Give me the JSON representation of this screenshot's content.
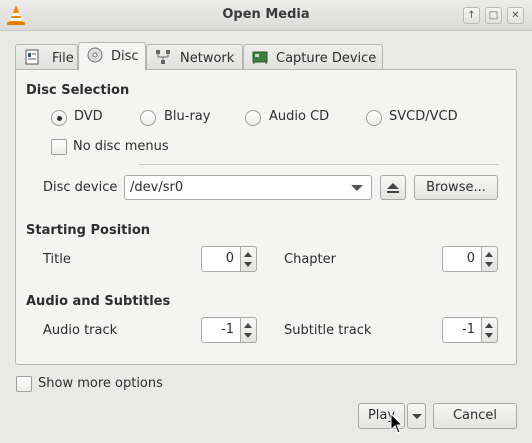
{
  "window": {
    "title": "Open Media",
    "controls": [
      "up-arrow-icon",
      "maximize-icon",
      "close-icon"
    ]
  },
  "tabs": [
    {
      "label": "File",
      "icon": "file-icon",
      "active": false
    },
    {
      "label": "Disc",
      "icon": "disc-icon",
      "active": true
    },
    {
      "label": "Network",
      "icon": "network-icon",
      "active": false
    },
    {
      "label": "Capture Device",
      "icon": "capture-card-icon",
      "active": false
    }
  ],
  "disc_selection": {
    "title": "Disc Selection",
    "options": [
      {
        "label": "DVD",
        "selected": true
      },
      {
        "label": "Blu-ray",
        "selected": false
      },
      {
        "label": "Audio CD",
        "selected": false
      },
      {
        "label": "SVCD/VCD",
        "selected": false
      }
    ],
    "no_menus_label": "No disc menus",
    "no_menus_checked": false,
    "device_label": "Disc device",
    "device_value": "/dev/sr0",
    "browse_label": "Browse..."
  },
  "starting_position": {
    "title": "Starting Position",
    "title_label": "Title",
    "title_value": "0",
    "chapter_label": "Chapter",
    "chapter_value": "0"
  },
  "audio_subtitles": {
    "title": "Audio and Subtitles",
    "audio_label": "Audio track",
    "audio_value": "-1",
    "subtitle_label": "Subtitle track",
    "subtitle_value": "-1"
  },
  "footer": {
    "show_more_label": "Show more options",
    "show_more_checked": false,
    "play_label": "Play",
    "cancel_label": "Cancel"
  }
}
